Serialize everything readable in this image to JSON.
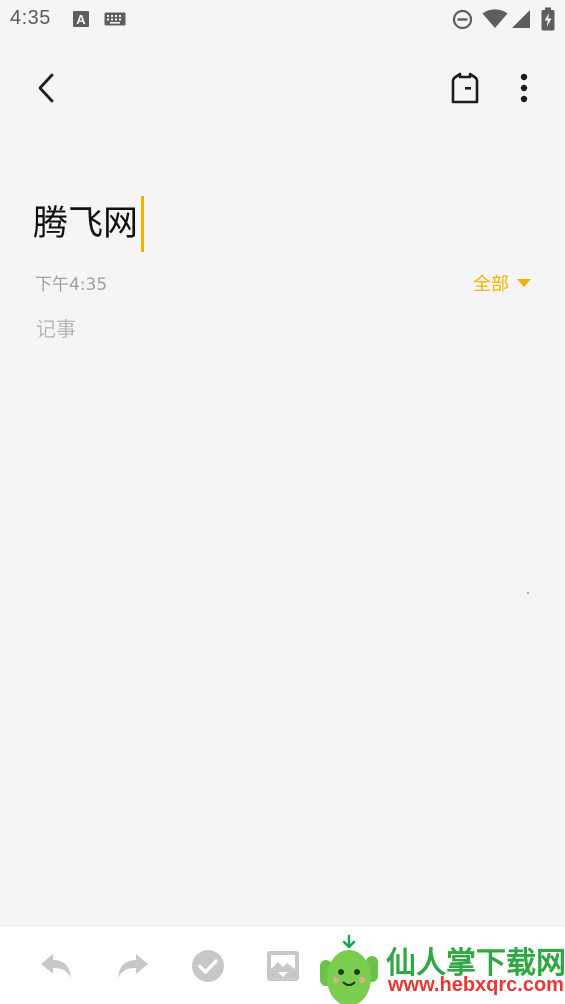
{
  "status_bar": {
    "time": "4:35",
    "icons": [
      "font-a-icon",
      "keyboard-icon",
      "do-not-disturb-icon",
      "wifi-icon",
      "signal-icon",
      "battery-charging-icon"
    ]
  },
  "toolbar": {
    "back_icon": "chevron-left-icon",
    "tag_icon": "tag-outline-icon",
    "more_icon": "more-vertical-icon"
  },
  "note": {
    "title": "腾飞网",
    "time": "下午4:35",
    "folder": "全部",
    "body_placeholder": "记事"
  },
  "bottom_toolbar": {
    "items": [
      "undo-icon",
      "redo-icon",
      "checklist-icon",
      "image-icon"
    ]
  },
  "watermark": {
    "brand": "仙人掌下载网",
    "url": "www.hebxqrc.com"
  },
  "colors": {
    "accent": "#f0b400",
    "background": "#f5f5f5",
    "text_primary": "#111111",
    "text_secondary": "#a0a0a0",
    "icon_inactive": "#c8c8c8",
    "watermark_green": "#2fa842",
    "watermark_red": "#e53935"
  }
}
